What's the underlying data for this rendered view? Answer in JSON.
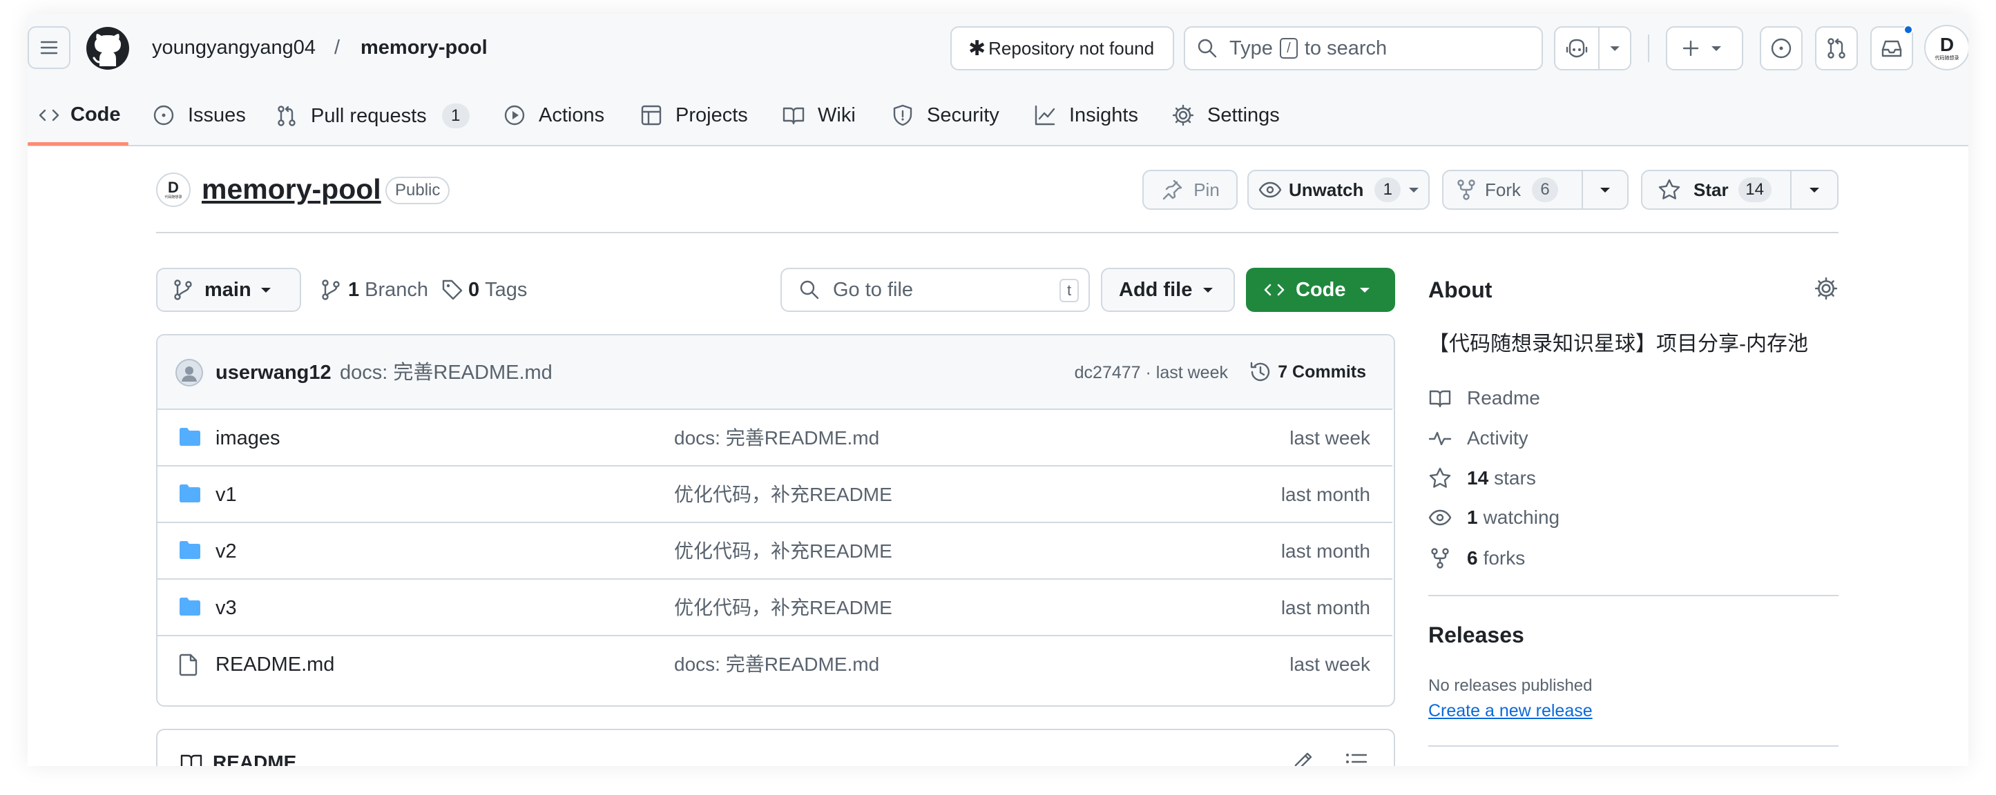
{
  "header": {
    "owner": "youngyangyang04",
    "separator": "/",
    "repo": "memory-pool",
    "repo_not_found": "Repository not found",
    "search_type": "Type",
    "search_key": "/",
    "search_rest": "to search"
  },
  "tabs": [
    {
      "label": "Code"
    },
    {
      "label": "Issues"
    },
    {
      "label": "Pull requests",
      "count": "1"
    },
    {
      "label": "Actions"
    },
    {
      "label": "Projects"
    },
    {
      "label": "Wiki"
    },
    {
      "label": "Security"
    },
    {
      "label": "Insights"
    },
    {
      "label": "Settings"
    }
  ],
  "repo_head": {
    "avatar_letter": "D",
    "avatar_caption": "代码随想录",
    "name": "memory-pool",
    "visibility": "Public",
    "pin": "Pin",
    "unwatch": "Unwatch",
    "watch_count": "1",
    "fork": "Fork",
    "fork_count": "6",
    "star": "Star",
    "star_count": "14"
  },
  "toolbar": {
    "branch": "main",
    "branch_count": "1",
    "branch_label": "Branch",
    "tags_count": "0",
    "tags_label": "Tags",
    "goto_placeholder": "Go to file",
    "goto_key": "t",
    "add_file": "Add file",
    "code": "Code"
  },
  "commit": {
    "author": "userwang12",
    "message": "docs: 完善README.md",
    "hash_time": "dc27477 · last week",
    "commits": "7 Commits"
  },
  "files": [
    {
      "name": "images",
      "type": "folder",
      "message": "docs: 完善README.md",
      "time": "last week"
    },
    {
      "name": "v1",
      "type": "folder",
      "message": "优化代码，补充README",
      "time": "last month"
    },
    {
      "name": "v2",
      "type": "folder",
      "message": "优化代码，补充README",
      "time": "last month"
    },
    {
      "name": "v3",
      "type": "folder",
      "message": "优化代码，补充README",
      "time": "last month"
    },
    {
      "name": "README.md",
      "type": "file",
      "message": "docs: 完善README.md",
      "time": "last week"
    }
  ],
  "readme": {
    "title": "README"
  },
  "about": {
    "title": "About",
    "description": "【代码随想录知识星球】项目分享-内存池",
    "readme": "Readme",
    "activity": "Activity",
    "stars_count": "14",
    "stars_label": "stars",
    "watching_count": "1",
    "watching_label": "watching",
    "forks_count": "6",
    "forks_label": "forks"
  },
  "releases": {
    "title": "Releases",
    "none": "No releases published",
    "create": "Create a new release"
  },
  "colors": {
    "accent_green": "#1f883d",
    "link_blue": "#0969da",
    "tab_underline": "#fd8c73",
    "folder_blue": "#54aeff"
  }
}
